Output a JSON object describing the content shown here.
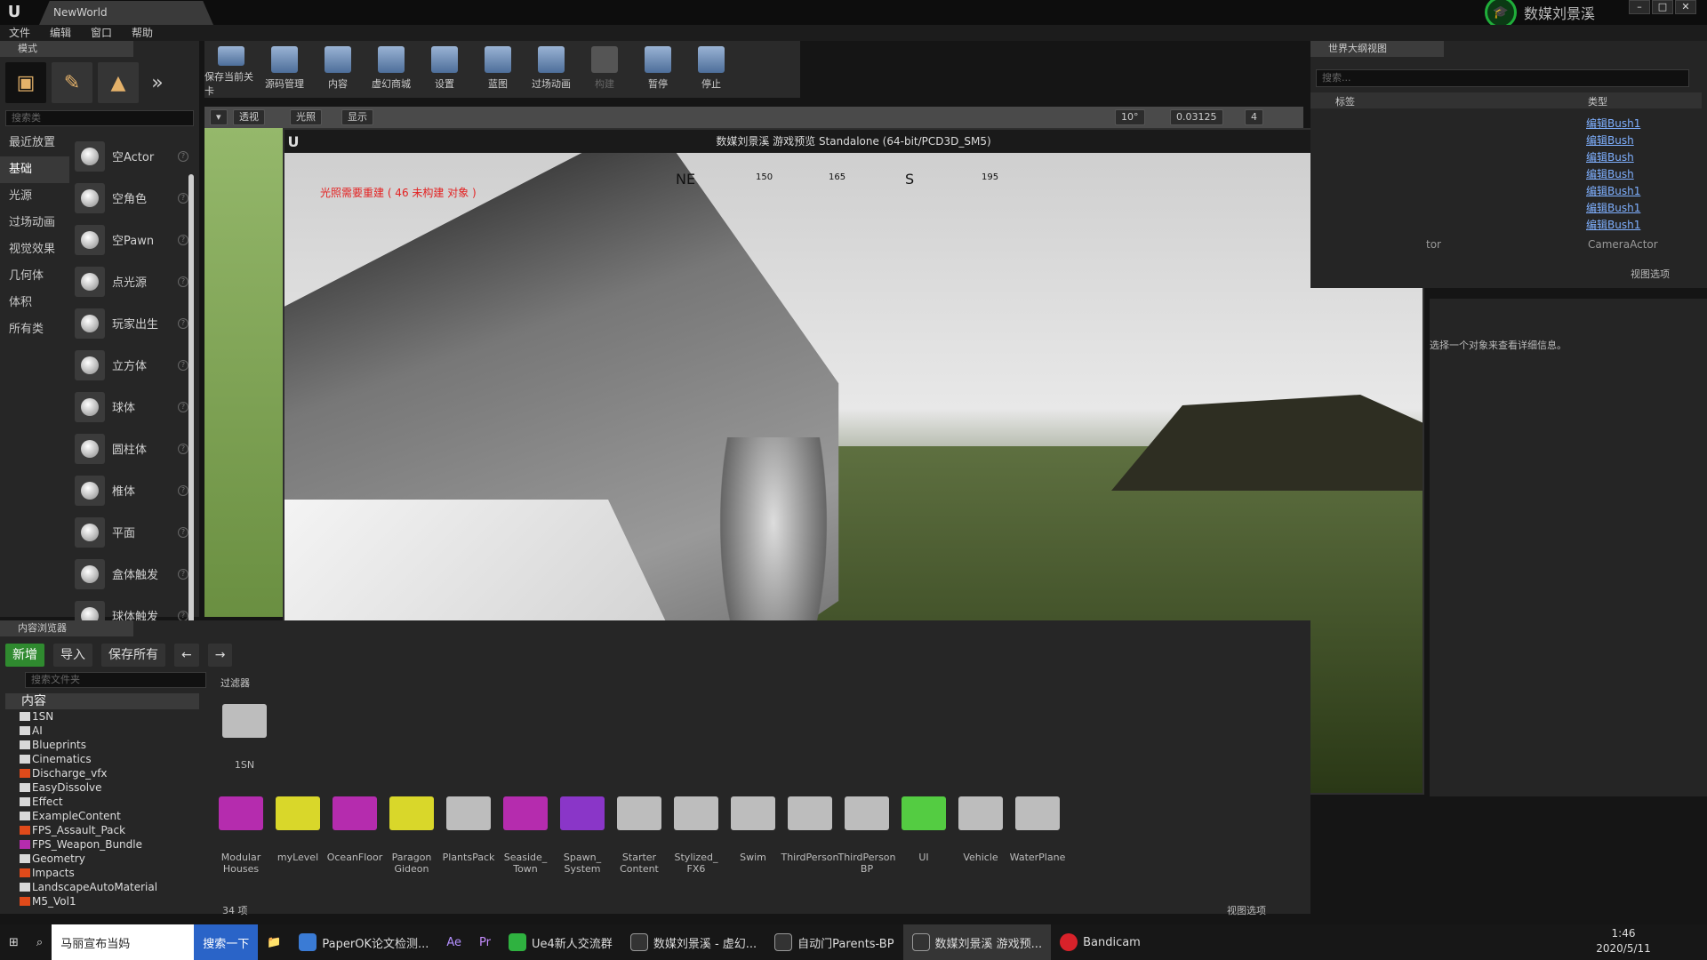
{
  "window": {
    "title": "NewWorld",
    "brand": "数媒刘景溪"
  },
  "menu": [
    "文件",
    "编辑",
    "窗口",
    "帮助"
  ],
  "modes": {
    "tab": "模式",
    "search_placeholder": "搜索类",
    "categories": [
      "最近放置",
      "基础",
      "光源",
      "过场动画",
      "视觉效果",
      "几何体",
      "体积",
      "所有类"
    ],
    "active_category": 1,
    "items": [
      "空Actor",
      "空角色",
      "空Pawn",
      "点光源",
      "玩家出生",
      "立方体",
      "球体",
      "圆柱体",
      "椎体",
      "平面",
      "盒体触发",
      "球体触发"
    ]
  },
  "toolbar": [
    "保存当前关卡",
    "源码管理",
    "内容",
    "虚幻商城",
    "设置",
    "蓝图",
    "过场动画",
    "构建",
    "暂停",
    "停止"
  ],
  "viewport": {
    "buttons": [
      "透视",
      "光照",
      "显示"
    ],
    "grid": "10°",
    "scale": "0.03125",
    "speed": "4"
  },
  "game": {
    "title": "数媒刘景溪 游戏预览 Standalone (64-bit/PCD3D_SM5)",
    "warning": "光照需要重建 ( 46 未构建 对象 )",
    "compass": [
      "NE",
      "150",
      "165",
      "S",
      "195"
    ]
  },
  "outliner": {
    "tab": "世界大纲视图",
    "search_placeholder": "搜索...",
    "col_label": "标签",
    "col_type": "类型",
    "types": [
      "编辑Bush1",
      "编辑Bush",
      "编辑Bush",
      "编辑Bush",
      "编辑Bush1",
      "编辑Bush1",
      "编辑Bush1"
    ],
    "camera_row": "tor",
    "camera_type": "CameraActor",
    "view_options": "视图选项"
  },
  "details": {
    "message": "选择一个对象来查看详细信息。"
  },
  "content_browser": {
    "tab": "内容浏览器",
    "new": "新增",
    "import": "导入",
    "save_all": "保存所有",
    "search_placeholder": "搜索文件夹",
    "filter": "过滤器",
    "root": "内容",
    "tree": [
      "1SN",
      "AI",
      "Blueprints",
      "Cinematics",
      "Discharge_vfx",
      "EasyDissolve",
      "Effect",
      "ExampleContent",
      "FPS_Assault_Pack",
      "FPS_Weapon_Bundle",
      "Geometry",
      "Impacts",
      "LandscapeAutoMaterial",
      "M5_Vol1"
    ],
    "top_folder": "1SN",
    "folders": [
      {
        "name": "Modular\nHouses",
        "color": "#b52cae"
      },
      {
        "name": "myLevel",
        "color": "#d9d72a"
      },
      {
        "name": "OceanFloor",
        "color": "#b52cae"
      },
      {
        "name": "Paragon\nGideon",
        "color": "#d9d72a"
      },
      {
        "name": "PlantsPack",
        "color": "#bdbdbd"
      },
      {
        "name": "Seaside_\nTown",
        "color": "#b52cae"
      },
      {
        "name": "Spawn_\nSystem",
        "color": "#8a36c8"
      },
      {
        "name": "Starter\nContent",
        "color": "#bdbdbd"
      },
      {
        "name": "Stylized_\nFX6",
        "color": "#bdbdbd"
      },
      {
        "name": "Swim",
        "color": "#bdbdbd"
      },
      {
        "name": "ThirdPerson",
        "color": "#bdbdbd"
      },
      {
        "name": "ThirdPerson\nBP",
        "color": "#bdbdbd"
      },
      {
        "name": "UI",
        "color": "#54cc42"
      },
      {
        "name": "Vehicle",
        "color": "#bdbdbd"
      },
      {
        "name": "WaterPlane",
        "color": "#bdbdbd"
      }
    ],
    "count": "34 项",
    "view_options": "视图选项"
  },
  "taskbar": {
    "search_text": "马丽宣布当妈",
    "search_btn": "搜索一下",
    "apps": [
      "PaperOK论文检测...",
      "Ae",
      "Pr",
      "Ue4新人交流群",
      "数媒刘景溪 - 虚幻...",
      "自动门Parents-BP",
      "数媒刘景溪 游戏预...",
      "Bandicam"
    ],
    "active_app": 6,
    "time": "1:46",
    "date": "2020/5/11"
  }
}
